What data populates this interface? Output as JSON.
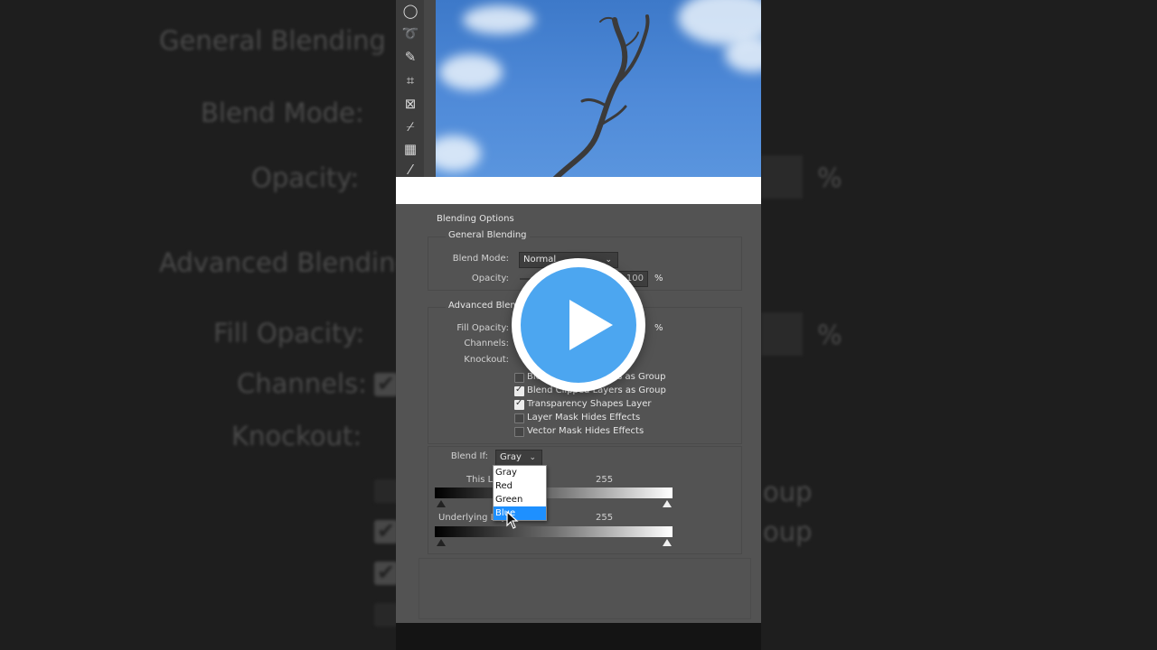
{
  "background": {
    "general_blending": "General Blending",
    "blend_mode_label": "Blend Mode:",
    "opacity_label": "Opacity:",
    "advanced_blending": "Advanced Blending",
    "fill_opacity_label": "Fill Opacity:",
    "channels_label": "Channels:",
    "knockout_label": "Knockout:",
    "percent": "%",
    "group_fragment_1": "oup",
    "group_fragment_2": "oup"
  },
  "dialog": {
    "title": "Blending Options",
    "general_blending": {
      "heading": "General Blending",
      "blend_mode_label": "Blend Mode:",
      "blend_mode_value": "Normal",
      "opacity_label": "Opacity:",
      "opacity_value": "100",
      "percent": "%"
    },
    "advanced_blending": {
      "heading": "Advanced Blending",
      "fill_opacity_label": "Fill Opacity:",
      "percent": "%",
      "channels_label": "Channels:",
      "knockout_label": "Knockout:",
      "options": [
        {
          "label": "Blend Interior Effects as Group",
          "checked": false
        },
        {
          "label": "Blend Clipped Layers as Group",
          "checked": true
        },
        {
          "label": "Transparency Shapes Layer",
          "checked": true
        },
        {
          "label": "Layer Mask Hides Effects",
          "checked": false
        },
        {
          "label": "Vector Mask Hides Effects",
          "checked": false
        }
      ]
    },
    "blend_if": {
      "label": "Blend If:",
      "selected": "Gray",
      "dropdown_options": [
        "Gray",
        "Red",
        "Green",
        "Blue"
      ],
      "highlighted_option": "Blue",
      "this_layer_label": "This Layer:",
      "this_layer_max": "255",
      "underlying_label": "Underlying Layer:",
      "underlying_max": "255"
    }
  },
  "colors": {
    "sky": "#4f8ad8",
    "play_button": "#4ca6f0",
    "dropdown_highlight": "#1e90ff"
  }
}
